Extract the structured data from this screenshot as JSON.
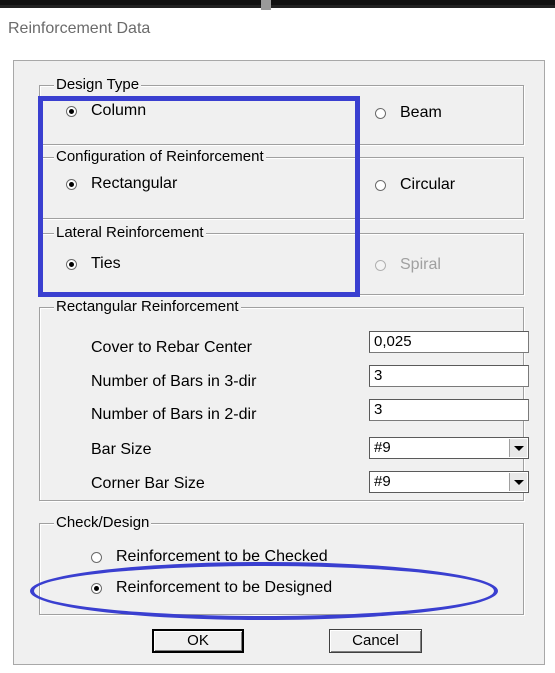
{
  "window": {
    "title": "Reinforcement Data"
  },
  "design_type": {
    "label": "Design Type",
    "options": [
      {
        "label": "Column",
        "checked": true,
        "enabled": true
      },
      {
        "label": "Beam",
        "checked": false,
        "enabled": true
      }
    ]
  },
  "configuration": {
    "label": "Configuration of Reinforcement",
    "options": [
      {
        "label": "Rectangular",
        "checked": true,
        "enabled": true
      },
      {
        "label": "Circular",
        "checked": false,
        "enabled": true
      }
    ]
  },
  "lateral": {
    "label": "Lateral Reinforcement",
    "options": [
      {
        "label": "Ties",
        "checked": true,
        "enabled": true
      },
      {
        "label": "Spiral",
        "checked": false,
        "enabled": false
      }
    ]
  },
  "rectangular": {
    "label": "Rectangular Reinforcement",
    "fields": [
      {
        "label": "Cover to Rebar Center",
        "value": "0,025",
        "type": "text"
      },
      {
        "label": "Number of Bars in 3-dir",
        "value": "3",
        "type": "text"
      },
      {
        "label": "Number of Bars in 2-dir",
        "value": "3",
        "type": "text"
      },
      {
        "label": "Bar Size",
        "value": "#9",
        "type": "combo"
      },
      {
        "label": "Corner Bar Size",
        "value": "#9",
        "type": "combo"
      }
    ]
  },
  "check_design": {
    "label": "Check/Design",
    "options": [
      {
        "label": "Reinforcement to be Checked",
        "checked": false,
        "enabled": true
      },
      {
        "label": "Reinforcement to be Designed",
        "checked": true,
        "enabled": true
      }
    ]
  },
  "buttons": {
    "ok": "OK",
    "cancel": "Cancel"
  },
  "annotation_color": "#3a3fd0"
}
